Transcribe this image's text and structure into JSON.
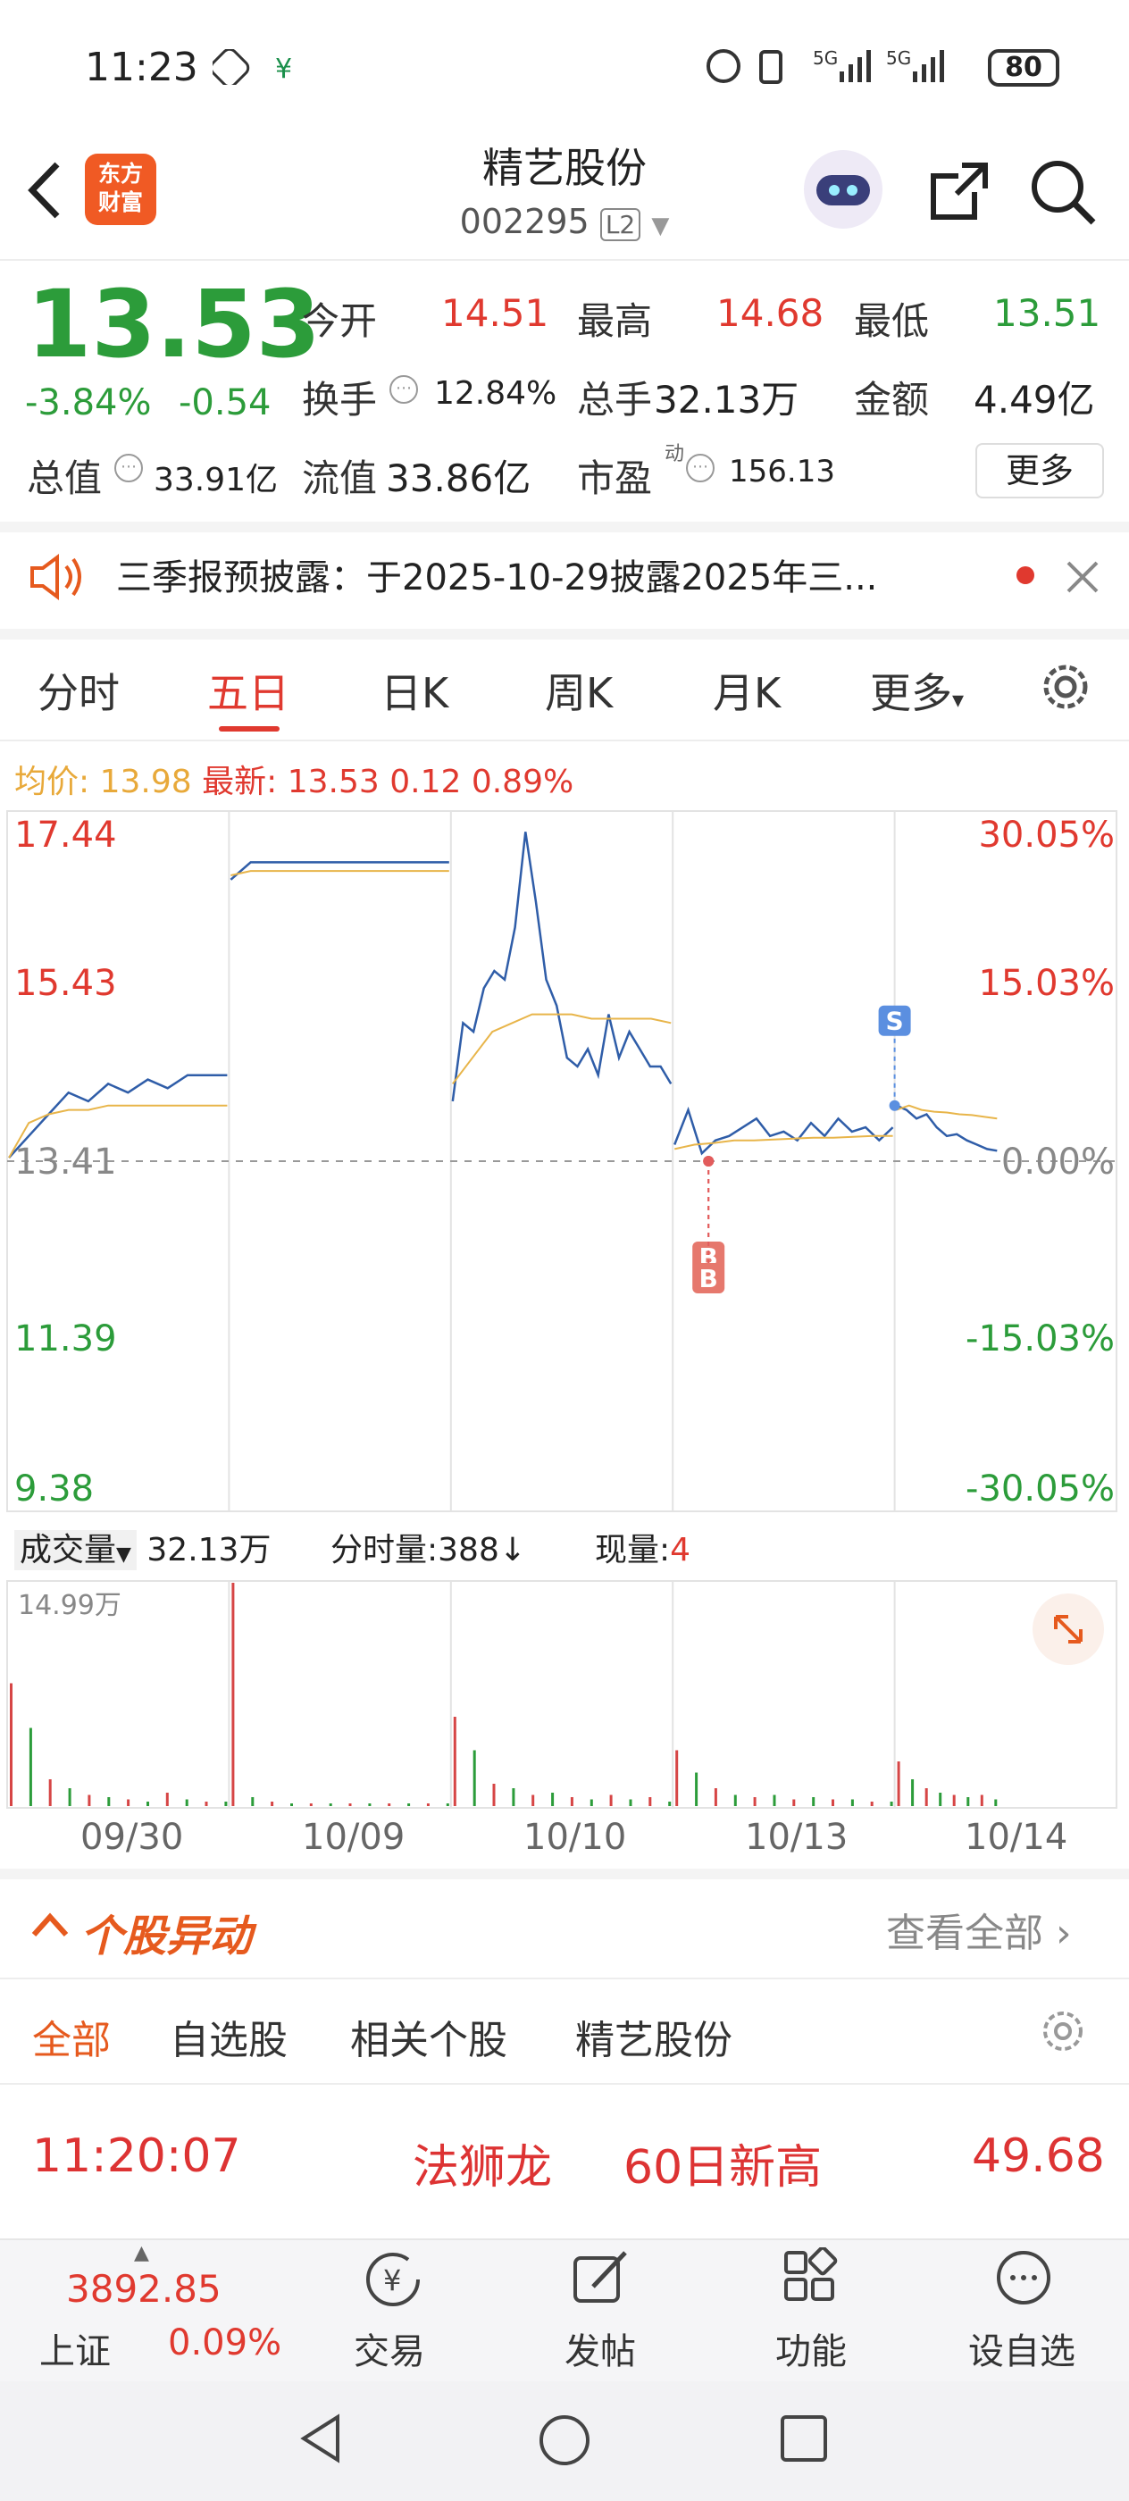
{
  "status_bar": {
    "time": "11:23",
    "battery": "80"
  },
  "header": {
    "logo_text_1": "东方",
    "logo_text_2": "财富",
    "title": "精艺股份",
    "code": "002295",
    "level": "L2"
  },
  "quote": {
    "price": "13.53",
    "change_pct": "-3.84%",
    "change": "-0.54",
    "open_label": "今开",
    "open": "14.51",
    "high_label": "最高",
    "high": "14.68",
    "low_label": "最低",
    "low": "13.51",
    "turnover_label": "换手",
    "turnover": "12.84%",
    "volume_label": "总手",
    "volume": "32.13万",
    "amount_label": "金额",
    "amount": "4.49亿",
    "mktcap_label": "总值",
    "mktcap": "33.91亿",
    "float_label": "流值",
    "float": "33.86亿",
    "pe_label": "市盈",
    "pe_sup": "动",
    "pe": "156.13",
    "more_label": "更多"
  },
  "notice": {
    "text": "三季报预披露：于2025-10-29披露2025年三..."
  },
  "tabs": [
    "分时",
    "五日",
    "日K",
    "周K",
    "月K",
    "更多"
  ],
  "chart_header": {
    "avg_label": "均价:",
    "avg": "13.98",
    "latest_label": "最新:",
    "latest": "13.53",
    "chg": "0.12",
    "chg_pct": "0.89%"
  },
  "chart_data": {
    "type": "line",
    "y_left_ticks": [
      "17.44",
      "15.43",
      "13.41",
      "11.39",
      "9.38"
    ],
    "y_right_ticks": [
      "30.05%",
      "15.03%",
      "0.00%",
      "-15.03%",
      "-30.05%"
    ],
    "ylim": [
      9.38,
      17.44
    ],
    "days": [
      "09/30",
      "10/09",
      "10/10",
      "10/13",
      "10/14"
    ],
    "series": [
      {
        "values": [
          [
            13.45,
            13.7,
            13.95,
            14.2,
            14.1,
            14.3,
            14.2,
            14.35,
            14.25,
            14.4,
            14.4,
            14.4
          ],
          [
            16.65,
            16.85,
            16.85,
            16.85,
            16.85,
            16.85,
            16.85,
            16.85,
            16.85,
            16.85,
            16.85,
            16.85
          ],
          [
            14.1,
            15.0,
            14.9,
            15.4,
            15.6,
            15.5,
            16.1,
            17.2,
            16.4,
            15.5,
            15.2,
            14.6,
            14.5,
            14.7,
            14.4,
            15.1,
            14.6,
            14.9,
            14.7,
            14.5,
            14.5,
            14.3
          ],
          [
            13.6,
            14.0,
            13.5,
            13.65,
            13.7,
            13.8,
            13.9,
            13.7,
            13.75,
            13.65,
            13.85,
            13.7,
            13.9,
            13.75,
            13.8,
            13.65,
            13.8
          ],
          [
            14.05,
            14.0,
            13.9,
            13.95,
            13.8,
            13.7,
            13.72,
            13.65,
            13.6,
            13.55,
            13.53
          ]
        ]
      },
      {
        "values": [
          [
            13.45,
            13.85,
            13.95,
            14.0,
            14.0,
            14.05,
            14.05,
            14.05,
            14.05,
            14.05,
            14.05,
            14.05
          ],
          [
            16.7,
            16.75,
            16.75,
            16.75,
            16.75,
            16.75,
            16.75,
            16.75,
            16.75,
            16.75,
            16.75,
            16.75
          ],
          [
            14.3,
            14.6,
            14.9,
            15.0,
            15.1,
            15.1,
            15.1,
            15.05,
            15.05,
            15.05,
            15.05,
            15.0
          ],
          [
            13.55,
            13.6,
            13.62,
            13.65,
            13.65,
            13.66,
            13.67,
            13.68,
            13.68,
            13.69,
            13.7,
            13.7
          ],
          [
            14.0,
            14.05,
            14.0,
            13.98,
            13.97,
            13.95,
            13.94,
            13.92,
            13.9
          ]
        ]
      }
    ],
    "markers": [
      {
        "label": "S",
        "day": 4,
        "value": 14.05
      },
      {
        "label": "B",
        "day": 3,
        "value": 13.41
      },
      {
        "label": "B",
        "day": 3,
        "value": 13.41
      }
    ]
  },
  "volume_header": {
    "select": "成交量",
    "total": "32.13万",
    "tick_label": "分时量:388",
    "arrow": "↓",
    "now_label": "现量:",
    "now": "4"
  },
  "volume_chart": {
    "ymax_label": "14.99万",
    "peaks": [
      [
        0.55,
        0.35,
        0.12,
        0.08,
        0.05,
        0.04,
        0.03,
        0.02,
        0.06,
        0.03,
        0.02,
        0.02
      ],
      [
        1.0,
        0.04,
        0.02,
        0.01,
        0.01,
        0.01,
        0.01,
        0.01,
        0.01,
        0.01,
        0.01,
        0.01
      ],
      [
        0.4,
        0.25,
        0.1,
        0.08,
        0.05,
        0.06,
        0.04,
        0.03,
        0.05,
        0.03,
        0.04,
        0.02
      ],
      [
        0.25,
        0.15,
        0.08,
        0.05,
        0.04,
        0.05,
        0.03,
        0.04,
        0.03,
        0.03,
        0.02,
        0.02
      ],
      [
        0.2,
        0.12,
        0.08,
        0.06,
        0.05,
        0.04,
        0.05,
        0.03
      ]
    ]
  },
  "anomaly": {
    "title": "个股异动",
    "view_all": "查看全部",
    "subtabs": [
      "全部",
      "自选股",
      "相关个股",
      "精艺股份"
    ],
    "row": {
      "time": "11:20:07",
      "stock": "法狮龙",
      "event": "60日新高",
      "value": "49.68"
    }
  },
  "bottom": {
    "index_value": "3892.85",
    "index_name": "上证",
    "index_pct": "0.09%",
    "nav": [
      "交易",
      "发帖",
      "功能",
      "设自选"
    ]
  }
}
